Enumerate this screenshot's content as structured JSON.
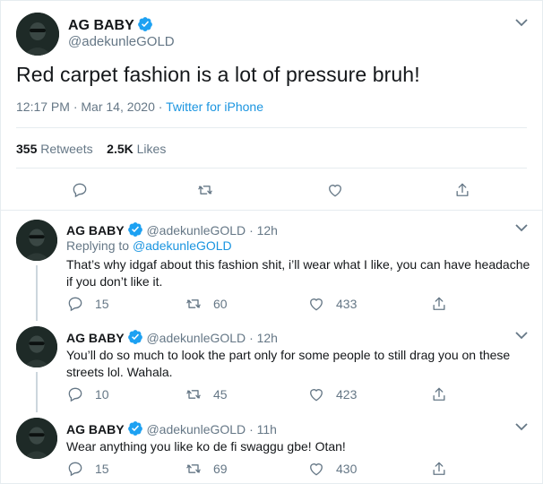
{
  "main_tweet": {
    "author_name": "AG BABY",
    "author_handle": "@adekunleGOLD",
    "text": "Red carpet fashion is a lot of pressure bruh!",
    "time": "12:17 PM · Mar 14, 2020 · ",
    "source": "Twitter for iPhone",
    "retweets_count": "355",
    "retweets_label": "Retweets",
    "likes_count": "2.5K",
    "likes_label": "Likes"
  },
  "replies": [
    {
      "author_name": "AG BABY",
      "author_handle": "@adekunleGOLD",
      "age": "· 12h",
      "replying_label": "Replying to",
      "replying_to": "@adekunleGOLD",
      "text": "That’s why idgaf about this fashion shit, i’ll wear what I like, you can have headache if you don’t like it.",
      "replies": "15",
      "retweets": "60",
      "likes": "433"
    },
    {
      "author_name": "AG BABY",
      "author_handle": "@adekunleGOLD",
      "age": "· 12h",
      "text": "You’ll do so much to look the part only for some people to still drag you on these streets lol. Wahala.",
      "replies": "10",
      "retweets": "45",
      "likes": "423"
    },
    {
      "author_name": "AG BABY",
      "author_handle": "@adekunleGOLD",
      "age": "· 11h",
      "text": "Wear anything you like ko de fi swaggu gbe! Otan!",
      "replies": "15",
      "retweets": "69",
      "likes": "430"
    }
  ],
  "colors": {
    "text": "#14171a",
    "secondary": "#657786",
    "link": "#1b95e0",
    "divider": "#e6ecf0",
    "verified": "#1da1f2"
  },
  "icons": [
    "verified-badge-icon",
    "chevron-down-icon",
    "reply-icon",
    "retweet-icon",
    "like-icon",
    "share-icon"
  ]
}
